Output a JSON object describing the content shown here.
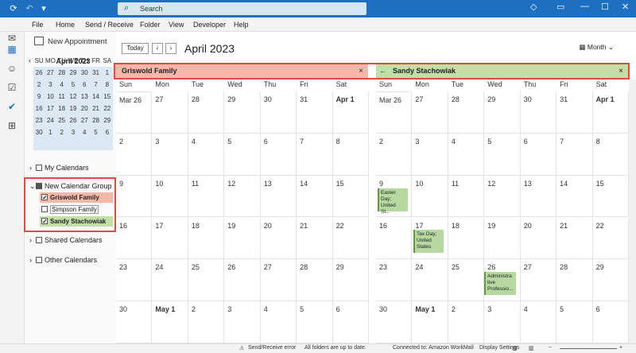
{
  "search": {
    "placeholder": "Search"
  },
  "ribbon": [
    "File",
    "Home",
    "Send / Receive",
    "Folder",
    "View",
    "Developer",
    "Help"
  ],
  "nav": {
    "new_appointment": "New Appointment",
    "minical": {
      "title": "April 2023",
      "dow": [
        "SU",
        "MO",
        "TU",
        "WE",
        "TH",
        "FR",
        "SA"
      ],
      "rows": [
        [
          "26",
          "27",
          "28",
          "29",
          "30",
          "31",
          "1"
        ],
        [
          "2",
          "3",
          "4",
          "5",
          "6",
          "7",
          "8"
        ],
        [
          "9",
          "10",
          "11",
          "12",
          "13",
          "14",
          "15"
        ],
        [
          "16",
          "17",
          "18",
          "19",
          "20",
          "21",
          "22"
        ],
        [
          "23",
          "24",
          "25",
          "26",
          "27",
          "28",
          "29"
        ],
        [
          "30",
          "1",
          "2",
          "3",
          "4",
          "5",
          "6"
        ]
      ]
    },
    "my_calendars": "My Calendars",
    "group": "New Calendar Group",
    "cal1": "Griswold Family",
    "cal2": "Simpson Family",
    "cal3": "Sandy Stachowiak",
    "shared": "Shared Calendars",
    "other": "Other Calendars"
  },
  "toolbar": {
    "today": "Today",
    "prev": "‹",
    "next": "›",
    "month_title": "April 2023",
    "view": "Month"
  },
  "tabs": {
    "left": "Griswold Family",
    "right": "Sandy Stachowiak",
    "close": "×",
    "arrow": "←"
  },
  "colors": {
    "griswold": "#f4b8aa",
    "sandy": "#c2dfa8",
    "accent": "#1d6fc2",
    "outline": "#e14b3b"
  },
  "dow": [
    "Sun",
    "Mon",
    "Tue",
    "Wed",
    "Thu",
    "Fri",
    "Sat"
  ],
  "weeks": [
    [
      "Mar 26",
      "27",
      "28",
      "29",
      "30",
      "31",
      "Apr 1"
    ],
    [
      "2",
      "3",
      "4",
      "5",
      "6",
      "7",
      "8"
    ],
    [
      "9",
      "10",
      "11",
      "12",
      "13",
      "14",
      "15"
    ],
    [
      "16",
      "17",
      "18",
      "19",
      "20",
      "21",
      "22"
    ],
    [
      "23",
      "24",
      "25",
      "26",
      "27",
      "28",
      "29"
    ],
    [
      "30",
      "May 1",
      "2",
      "3",
      "4",
      "5",
      "6"
    ]
  ],
  "appointments": {
    "easter": "Easter Day; United St...",
    "tax": "Tax Day; United States",
    "admin": "Administra tive Professio..."
  },
  "status": {
    "error": "Send/Receive error",
    "folders": "All folders are up to date.",
    "connected": "Connected to: Amazon WorkMail",
    "display": "Display Settings"
  }
}
